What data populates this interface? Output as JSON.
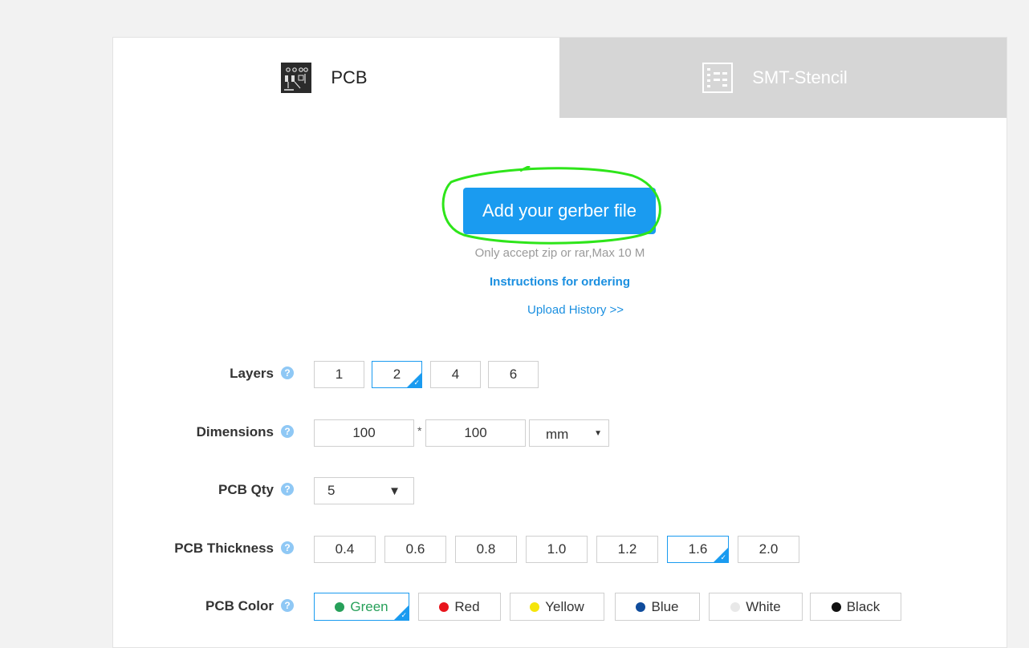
{
  "tabs": {
    "pcb": {
      "label": "PCB",
      "icon": "pcb-board-icon"
    },
    "smt": {
      "label": "SMT-Stencil",
      "icon": "stencil-icon"
    }
  },
  "upload": {
    "button_label": "Add your gerber file",
    "note": "Only accept zip or rar,Max 10 M",
    "instructions": "Instructions for ordering",
    "history": "Upload History >>"
  },
  "help_glyph": "?",
  "layers": {
    "label": "Layers",
    "options": [
      "1",
      "2",
      "4",
      "6"
    ],
    "selected": "2"
  },
  "dimensions": {
    "label": "Dimensions",
    "width": "100",
    "separator": "*",
    "height": "100",
    "unit": "mm",
    "unit_arrow": "▼"
  },
  "qty": {
    "label": "PCB Qty",
    "value": "5",
    "arrow": "▼"
  },
  "thickness": {
    "label": "PCB Thickness",
    "options": [
      "0.4",
      "0.6",
      "0.8",
      "1.0",
      "1.2",
      "1.6",
      "2.0"
    ],
    "selected": "1.6"
  },
  "color": {
    "label": "PCB Color",
    "options": [
      {
        "name": "Green",
        "color": "#27a05a"
      },
      {
        "name": "Red",
        "color": "#e8141c"
      },
      {
        "name": "Yellow",
        "color": "#f5e50a"
      },
      {
        "name": "Blue",
        "color": "#0f4c9c"
      },
      {
        "name": "White",
        "color": "#e8e8e8"
      },
      {
        "name": "Black",
        "color": "#111111"
      }
    ],
    "selected": "Green"
  },
  "colors": {
    "accent": "#1a9bf0",
    "highlight_circle": "#2ee51a",
    "link": "#1a8fe0"
  }
}
